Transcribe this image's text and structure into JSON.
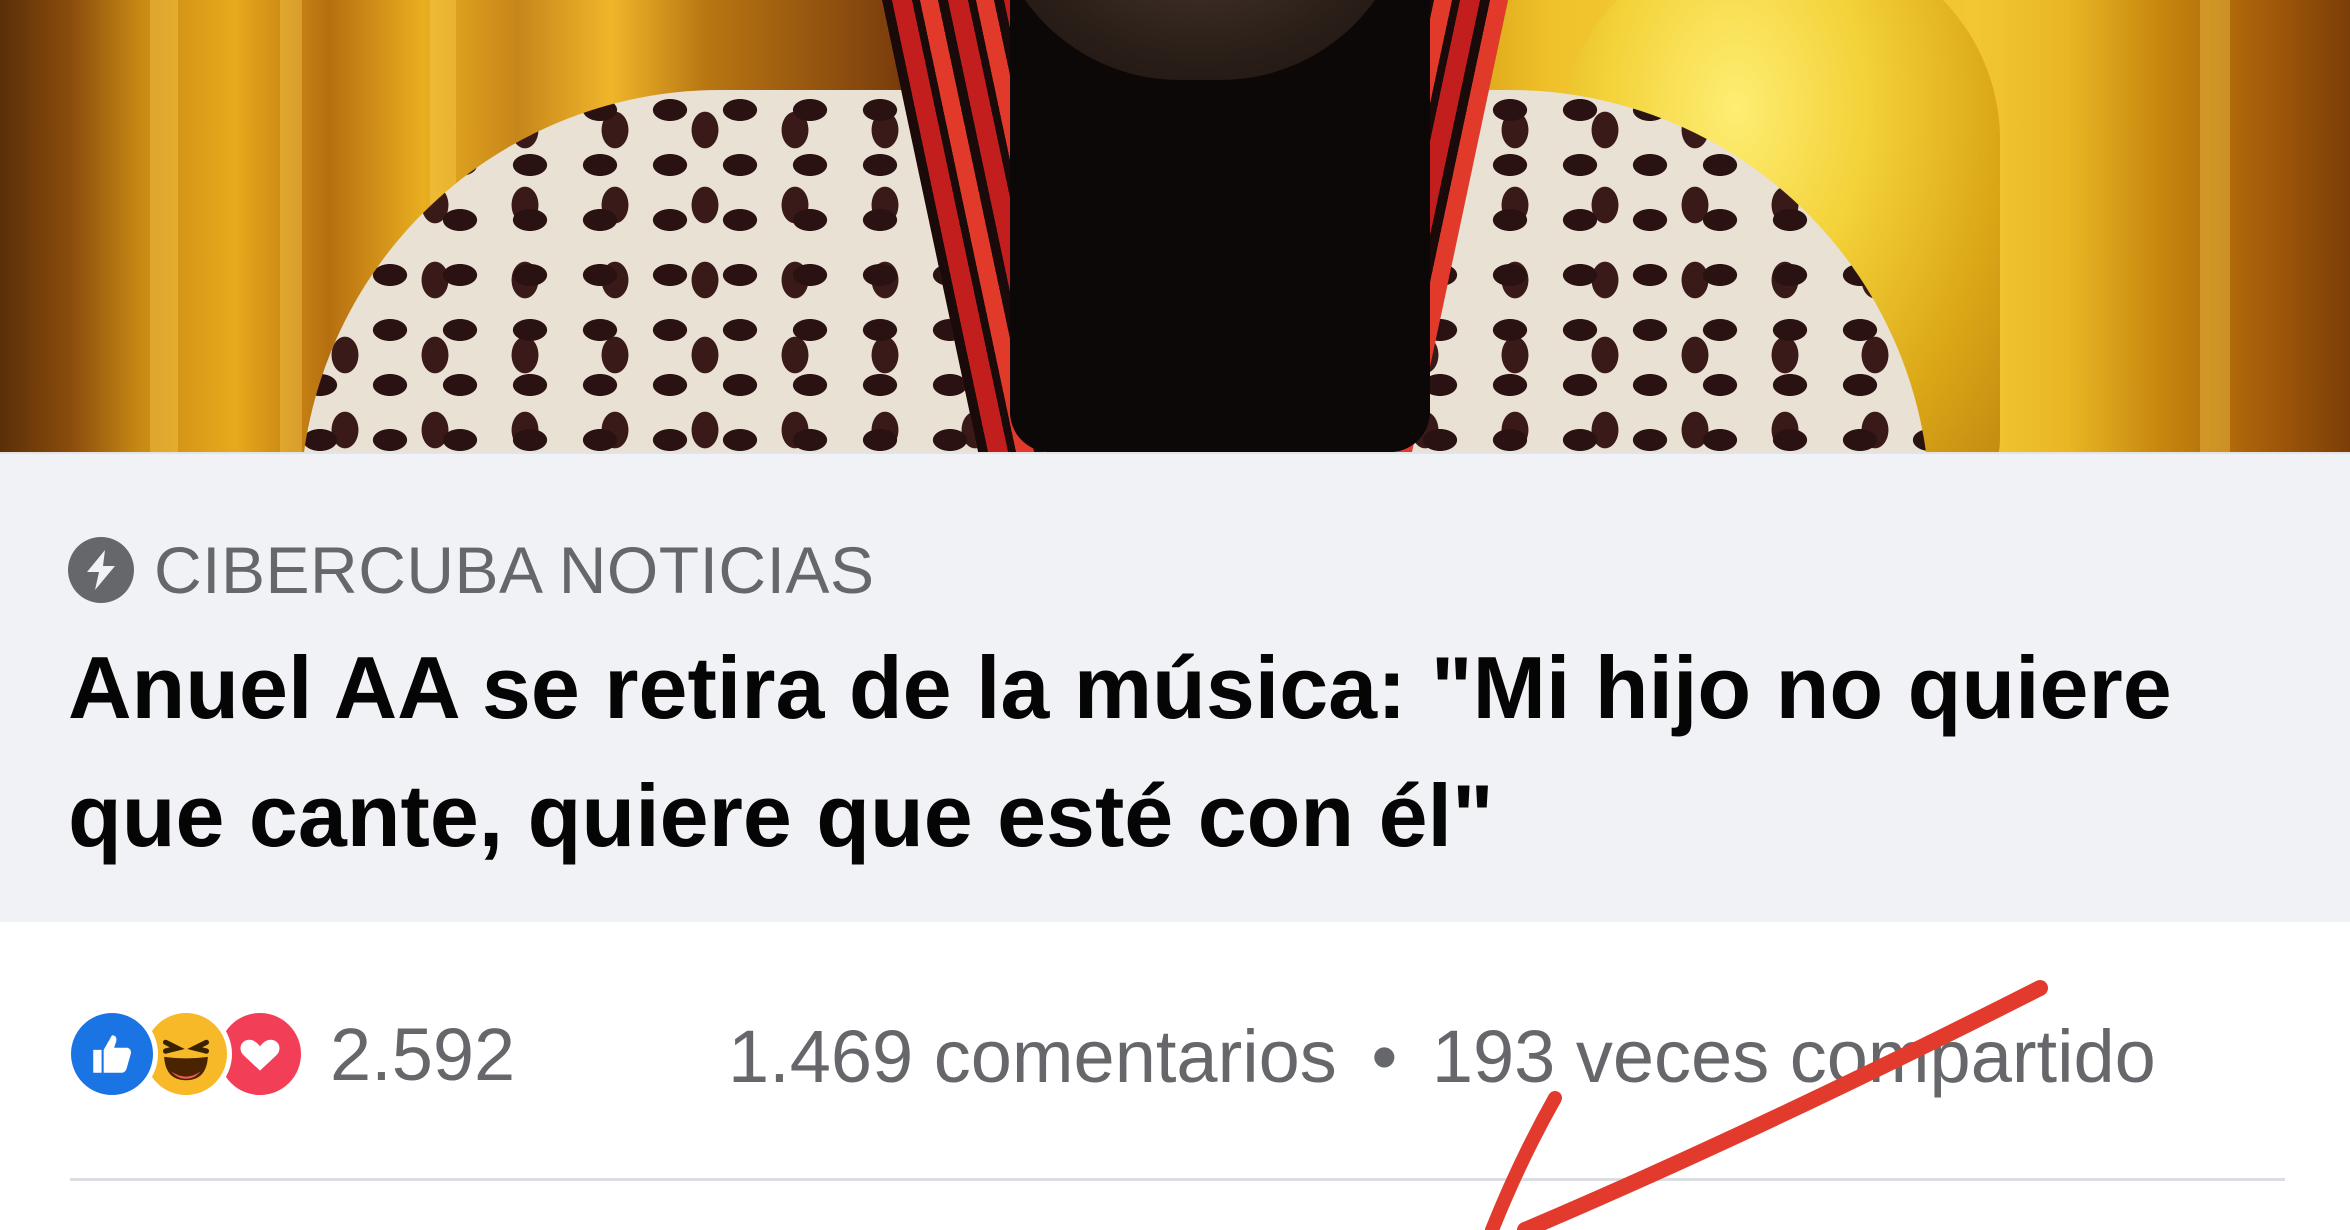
{
  "preview": {
    "source_icon": "lightning-bolt-icon",
    "source_name": "CIBERCUBA NOTICIAS",
    "headline": "Anuel AA se retira de la música: \"Mi hijo no quiere que cante, quiere que esté con él\""
  },
  "stats": {
    "reactions": [
      "like-icon",
      "haha-icon",
      "love-icon"
    ],
    "reaction_count": "2.592",
    "comments": "1.469 comentarios",
    "separator": "•",
    "shares": "193 veces compartido"
  },
  "colors": {
    "like": "#1b74e4",
    "haha": "#f7b928",
    "love": "#f33e58",
    "annotation_stroke": "#e23b2e",
    "preview_bg": "#f1f2f6"
  }
}
